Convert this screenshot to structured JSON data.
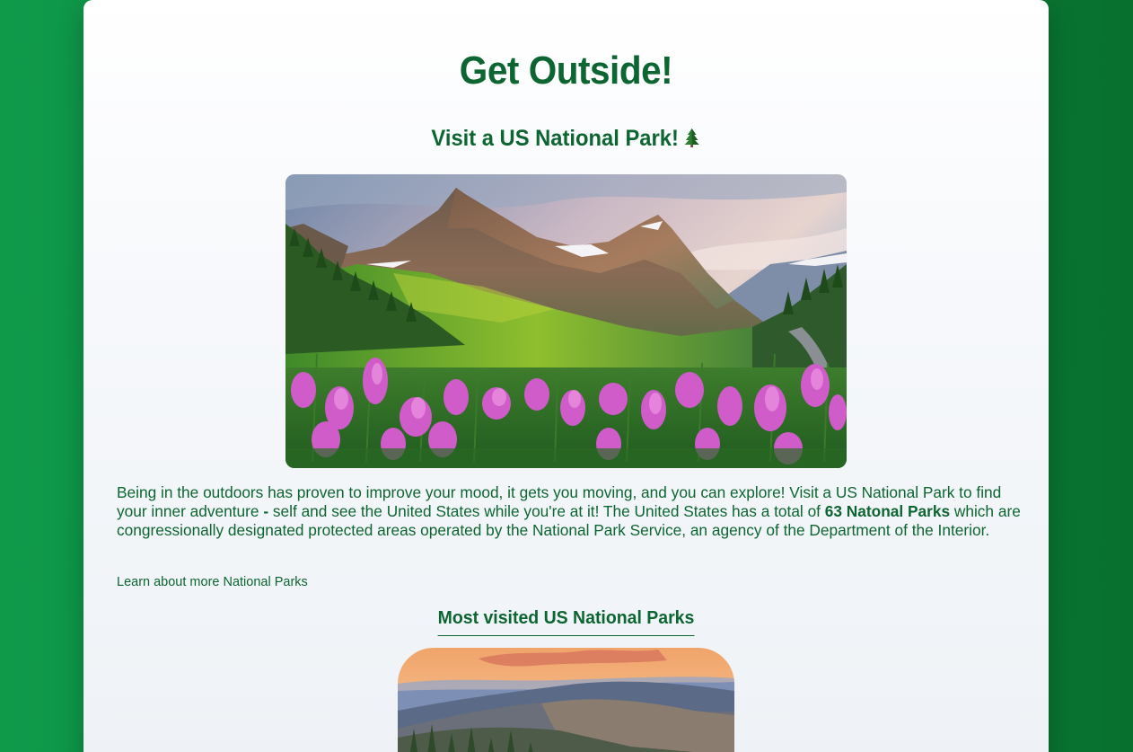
{
  "page": {
    "title": "Get Outside!",
    "subtitle": "Visit a US National Park!",
    "subtitle_icon": "evergreen-tree-icon"
  },
  "hero": {
    "image": "mountain-meadow-wildflowers-photo"
  },
  "intro": {
    "text_before": "Being in the outdoors has proven to improve your mood, it gets you moving, and you can explore! Visit a US National Park to find your inner adventure ",
    "dash": "-",
    "text_middle": " self and see the United States while you're at it! The United States has a total of ",
    "highlight": "63 Natonal Parks",
    "text_after": " which are congressionally designated protected areas operated by the National Park Service, an agency of the Department of the Interior."
  },
  "links": {
    "learn_more": "Learn about more National Parks"
  },
  "most_visited": {
    "heading": "Most visited US National Parks",
    "image": "smoky-mountains-sunset-photo"
  },
  "colors": {
    "background": "#0a8a3f",
    "text": "#0d6531",
    "card": "#ffffff"
  }
}
